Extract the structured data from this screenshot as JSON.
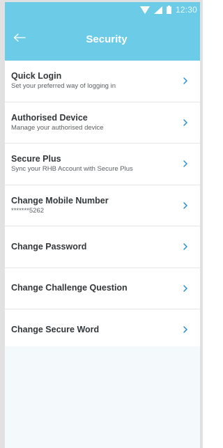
{
  "status_bar": {
    "time": "12:30",
    "icons": [
      "wifi-icon",
      "signal-icon",
      "battery-icon"
    ]
  },
  "header": {
    "title": "Security",
    "back_icon": "arrow-left-icon"
  },
  "colors": {
    "header_bg": "#6ccbe6",
    "chevron": "#1b8ccf",
    "page_bg": "#f4f9fc"
  },
  "items": [
    {
      "title": "Quick Login",
      "subtitle": "Set your preferred way of logging in"
    },
    {
      "title": "Authorised Device",
      "subtitle": "Manage your authorised device"
    },
    {
      "title": "Secure Plus",
      "subtitle": "Sync your RHB Account with Secure Plus"
    },
    {
      "title": "Change Mobile Number",
      "subtitle": "*******5262"
    },
    {
      "title": "Change Password",
      "subtitle": ""
    },
    {
      "title": "Change Challenge Question",
      "subtitle": ""
    },
    {
      "title": "Change Secure Word",
      "subtitle": ""
    }
  ]
}
